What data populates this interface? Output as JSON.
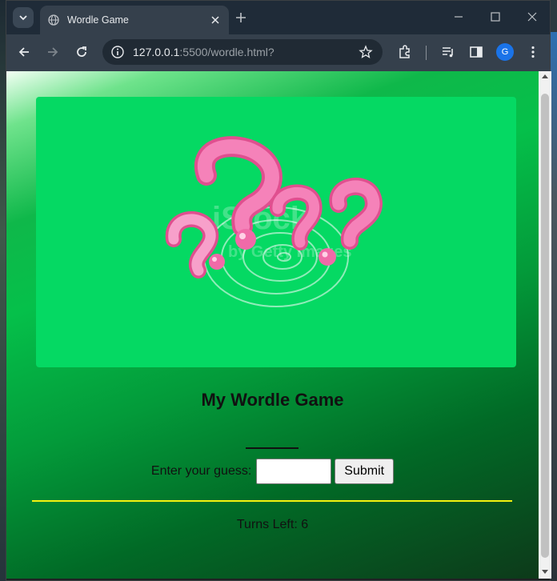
{
  "browser": {
    "tab_title": "Wordle Game",
    "url_host": "127.0.0.1",
    "url_rest": ":5500/wordle.html?",
    "profile_initial": "G"
  },
  "page": {
    "hero_image_desc": "question-marks-illustration",
    "heading": "My Wordle Game",
    "guess_label": "Enter your guess:",
    "guess_value": "",
    "submit_label": "Submit",
    "turns_text": "Turns Left: 6"
  },
  "colors": {
    "hero_bg": "#05d963",
    "divider": "#f3f20f",
    "accent_pink": "#f06aa8"
  }
}
